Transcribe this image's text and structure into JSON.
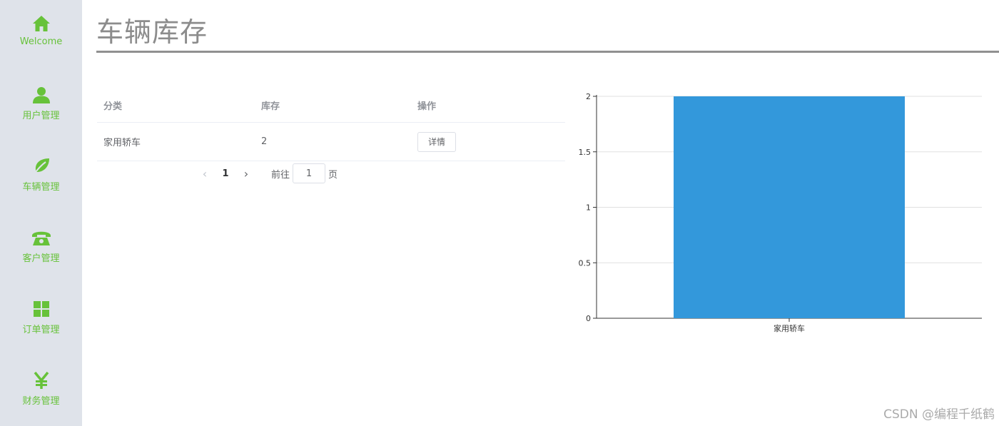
{
  "sidebar": {
    "items": [
      {
        "label": "Welcome",
        "icon": "home-icon"
      },
      {
        "label": "用户管理",
        "icon": "user-icon"
      },
      {
        "label": "车辆管理",
        "icon": "leaf-icon"
      },
      {
        "label": "客户管理",
        "icon": "phone-icon"
      },
      {
        "label": "订单管理",
        "icon": "grid-icon"
      },
      {
        "label": "财务管理",
        "icon": "yen-icon"
      }
    ],
    "accent": "#67c23a",
    "background": "#dfe3ea"
  },
  "header": {
    "title": "车辆库存"
  },
  "table": {
    "headers": [
      "分类",
      "库存",
      "操作"
    ],
    "rows": [
      {
        "category": "家用轿车",
        "stock": "2",
        "action": "详情"
      }
    ]
  },
  "pagination": {
    "prev": "‹",
    "current": "1",
    "next": "›",
    "goto_label": "前往",
    "goto_value": "1",
    "page_suffix": "页"
  },
  "chart_data": {
    "type": "bar",
    "categories": [
      "家用轿车"
    ],
    "values": [
      2
    ],
    "ylim": [
      0,
      2
    ],
    "yticks": [
      "0",
      "0.5",
      "1",
      "1.5",
      "2"
    ],
    "bar_color": "#3398db",
    "grid": true
  },
  "watermark": "CSDN @编程千纸鹤"
}
